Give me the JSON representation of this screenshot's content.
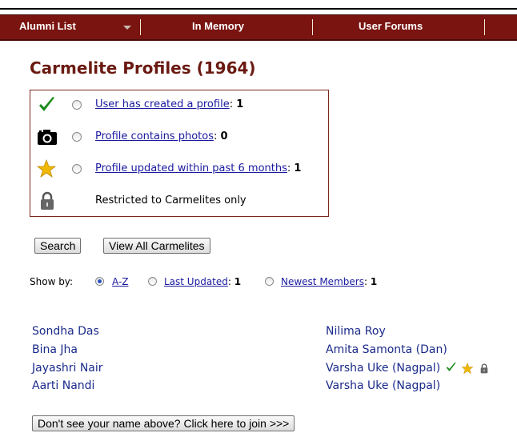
{
  "nav": {
    "items": [
      {
        "label": "Alumni List"
      },
      {
        "label": "In Memory"
      },
      {
        "label": "User Forums"
      }
    ]
  },
  "page": {
    "title": "Carmelite Profiles (1964)"
  },
  "legend": {
    "rows": [
      {
        "icon": "checkmark-icon",
        "label": "User has created a profile",
        "count": "1"
      },
      {
        "icon": "camera-icon",
        "label": "Profile contains photos",
        "count": "0"
      },
      {
        "icon": "star-icon",
        "label": "Profile updated within past 6 months",
        "count": "1"
      },
      {
        "icon": "lock-icon",
        "label": "Restricted to Carmelites only"
      }
    ]
  },
  "buttons": {
    "search": "Search",
    "view_all": "View All Carmelites",
    "join": "Don't see your name above? Click here to join >>>"
  },
  "show_by": {
    "label": "Show by:",
    "options": [
      {
        "label": "A-Z",
        "selected": true
      },
      {
        "label": "Last Updated",
        "count": "1"
      },
      {
        "label": "Newest Members",
        "count": "1"
      }
    ]
  },
  "names": {
    "left": [
      "Sondha Das",
      "Bina Jha",
      "Jayashri Nair",
      "Aarti Nandi"
    ],
    "right": [
      "Nilima Roy",
      "Amita Samonta (Dan)",
      "Varsha Uke (Nagpal)",
      "Varsha Uke (Nagpal)"
    ]
  },
  "colors": {
    "nav_bg": "#7a1410",
    "title": "#6a1a12",
    "link": "#1a1aa0",
    "check": "#1a8a1a",
    "star": "#f0b800"
  }
}
